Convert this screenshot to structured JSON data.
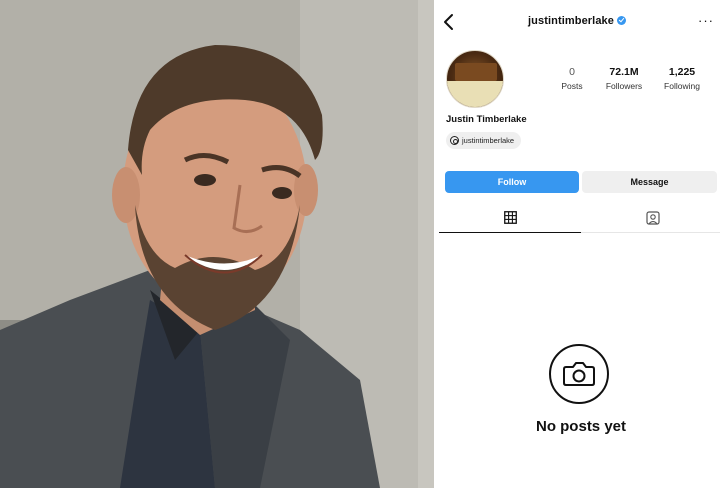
{
  "profile": {
    "username": "justintimberlake",
    "full_name": "Justin Timberlake",
    "threads_handle": "justintimberlake",
    "stats": [
      {
        "value": "0",
        "label": "Posts"
      },
      {
        "value": "72.1M",
        "label": "Followers"
      },
      {
        "value": "1,225",
        "label": "Following"
      }
    ],
    "buttons": {
      "follow": "Follow",
      "message": "Message"
    },
    "more_label": "···",
    "empty_state": "No posts yet"
  },
  "icons": {
    "back": "chevron-left-icon",
    "verified": "verified-badge-icon",
    "more": "more-horizontal-icon",
    "threads": "threads-icon",
    "grid": "grid-icon",
    "tagged": "tagged-icon",
    "camera": "camera-icon"
  },
  "colors": {
    "accent": "#3797f0",
    "button_secondary": "#efefef"
  }
}
